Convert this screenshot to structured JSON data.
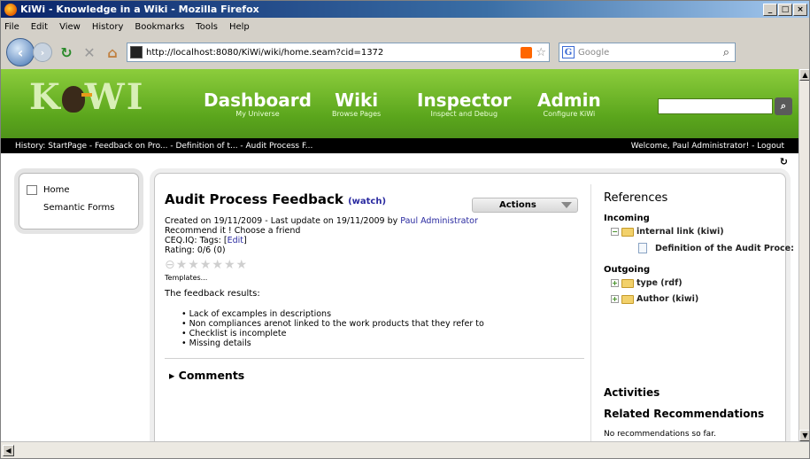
{
  "window": {
    "title": "KiWi - Knowledge in a Wiki - Mozilla Firefox"
  },
  "menubar": [
    "File",
    "Edit",
    "View",
    "History",
    "Bookmarks",
    "Tools",
    "Help"
  ],
  "navbar": {
    "url": "http://localhost:8080/KiWi/wiki/home.seam?cid=1372",
    "search_placeholder": "Google"
  },
  "kiwi": {
    "nav": [
      {
        "label": "Dashboard",
        "sub": "My Universe"
      },
      {
        "label": "Wiki",
        "sub": "Browse Pages"
      },
      {
        "label": "Inspector",
        "sub": "Inspect and Debug"
      },
      {
        "label": "Admin",
        "sub": "Configure KiWi"
      }
    ],
    "history": "History: StartPage - Feedback on Pro... - Definition of t... - Audit Process F...",
    "welcome": "Welcome, Paul Administrator! - Logout"
  },
  "left_menu": [
    "Home",
    "Semantic Forms"
  ],
  "page": {
    "title": "Audit Process Feedback",
    "watch": "(watch)",
    "actions": "Actions",
    "meta_created": "Created on 19/11/2009 - Last update on 19/11/2009 by ",
    "meta_author": "Paul Administrator",
    "recommend": "Recommend it ! Choose a friend",
    "tags_prefix": "CEQ.IQ: Tags: [",
    "tags_edit": "Edit",
    "tags_suffix": "]",
    "rating": "Rating: 0/6 (0)",
    "rating_value": 0,
    "rating_max": 6,
    "templates": "Templates...",
    "feedback_intro": "The feedback results:",
    "bullets": [
      "Lack of excamples in descriptions",
      "Non compliances arenot linked to the work products that they refer to",
      "Checklist is incomplete",
      "Missing details"
    ],
    "comments": "Comments"
  },
  "references": {
    "title": "References",
    "incoming_label": "Incoming",
    "incoming_item": "internal link (kiwi)",
    "incoming_child": "Definition of the Audit Proce:",
    "outgoing_label": "Outgoing",
    "outgoing_items": [
      "type (rdf)",
      "Author (kiwi)"
    ],
    "activities": "Activities",
    "related": "Related Recommendations",
    "no_recs": "No recommendations so far."
  }
}
